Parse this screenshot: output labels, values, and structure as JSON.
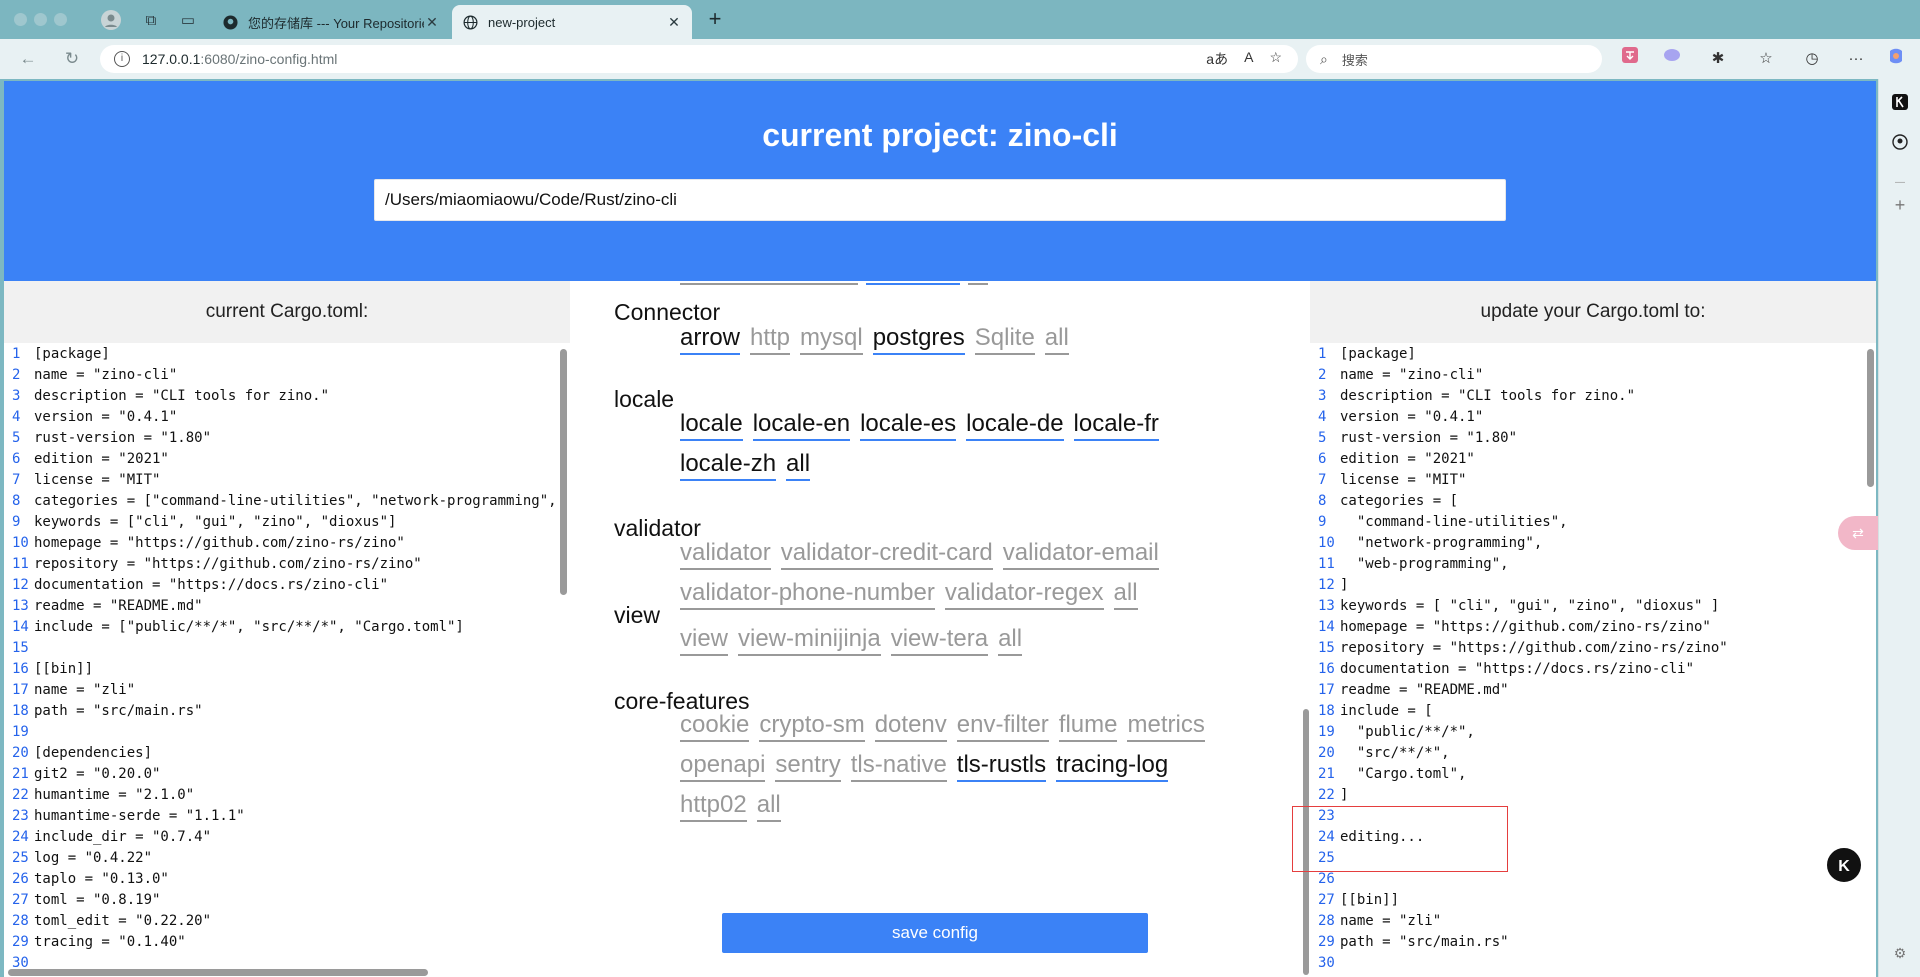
{
  "browser": {
    "tabs": [
      {
        "title": "您的存储库 --- Your Repositories",
        "active": false
      },
      {
        "title": "new-project",
        "active": true
      }
    ],
    "url_host": "127.0.0.1",
    "url_path": ":6080/zino-config.html",
    "search_placeholder": "搜索",
    "url_actions": [
      "aあ",
      "A",
      "☆"
    ]
  },
  "hero": {
    "title": "current project: zino-cli",
    "path_value": "/Users/miaomiaowu/Code/Rust/zino-cli"
  },
  "left_panel": {
    "title": "current Cargo.toml:",
    "lines": [
      {
        "n": "1",
        "t": "[package]"
      },
      {
        "n": "2",
        "t": "name = \"zino-cli\""
      },
      {
        "n": "3",
        "t": "description = \"CLI tools for zino.\""
      },
      {
        "n": "4",
        "t": "version = \"0.4.1\""
      },
      {
        "n": "5",
        "t": "rust-version = \"1.80\""
      },
      {
        "n": "6",
        "t": "edition = \"2021\""
      },
      {
        "n": "7",
        "t": "license = \"MIT\""
      },
      {
        "n": "8",
        "t": "categories = [\"command-line-utilities\", \"network-programming\","
      },
      {
        "n": "9",
        "t": "keywords = [\"cli\", \"gui\", \"zino\", \"dioxus\"]"
      },
      {
        "n": "10",
        "t": "homepage = \"https://github.com/zino-rs/zino\""
      },
      {
        "n": "11",
        "t": "repository = \"https://github.com/zino-rs/zino\""
      },
      {
        "n": "12",
        "t": "documentation = \"https://docs.rs/zino-cli\""
      },
      {
        "n": "13",
        "t": "readme = \"README.md\""
      },
      {
        "n": "14",
        "t": "include = [\"public/**/*\", \"src/**/*\", \"Cargo.toml\"]"
      },
      {
        "n": "15",
        "t": ""
      },
      {
        "n": "16",
        "t": "[[bin]]"
      },
      {
        "n": "17",
        "t": "name = \"zli\""
      },
      {
        "n": "18",
        "t": "path = \"src/main.rs\""
      },
      {
        "n": "19",
        "t": ""
      },
      {
        "n": "20",
        "t": "[dependencies]"
      },
      {
        "n": "21",
        "t": "git2 = \"0.20.0\""
      },
      {
        "n": "22",
        "t": "humantime = \"2.1.0\""
      },
      {
        "n": "23",
        "t": "humantime-serde = \"1.1.1\""
      },
      {
        "n": "24",
        "t": "include_dir = \"0.7.4\""
      },
      {
        "n": "25",
        "t": "log = \"0.4.22\""
      },
      {
        "n": "26",
        "t": "taplo = \"0.13.0\""
      },
      {
        "n": "27",
        "t": "toml = \"0.8.19\""
      },
      {
        "n": "28",
        "t": "toml_edit = \"0.22.20\""
      },
      {
        "n": "29",
        "t": "tracing = \"0.1.40\""
      },
      {
        "n": "30",
        "t": ""
      }
    ]
  },
  "right_panel": {
    "title": "update your Cargo.toml to:",
    "lines": [
      {
        "n": "1",
        "t": "[package]"
      },
      {
        "n": "2",
        "t": "name = \"zino-cli\""
      },
      {
        "n": "3",
        "t": "description = \"CLI tools for zino.\""
      },
      {
        "n": "4",
        "t": "version = \"0.4.1\""
      },
      {
        "n": "5",
        "t": "rust-version = \"1.80\""
      },
      {
        "n": "6",
        "t": "edition = \"2021\""
      },
      {
        "n": "7",
        "t": "license = \"MIT\""
      },
      {
        "n": "8",
        "t": "categories = ["
      },
      {
        "n": "9",
        "t": "  \"command-line-utilities\","
      },
      {
        "n": "10",
        "t": "  \"network-programming\","
      },
      {
        "n": "11",
        "t": "  \"web-programming\","
      },
      {
        "n": "12",
        "t": "]"
      },
      {
        "n": "13",
        "t": "keywords = [ \"cli\", \"gui\", \"zino\", \"dioxus\" ]"
      },
      {
        "n": "14",
        "t": "homepage = \"https://github.com/zino-rs/zino\""
      },
      {
        "n": "15",
        "t": "repository = \"https://github.com/zino-rs/zino\""
      },
      {
        "n": "16",
        "t": "documentation = \"https://docs.rs/zino-cli\""
      },
      {
        "n": "17",
        "t": "readme = \"README.md\""
      },
      {
        "n": "18",
        "t": "include = ["
      },
      {
        "n": "19",
        "t": "  \"public/**/*\","
      },
      {
        "n": "20",
        "t": "  \"src/**/*\","
      },
      {
        "n": "21",
        "t": "  \"Cargo.toml\","
      },
      {
        "n": "22",
        "t": "]"
      },
      {
        "n": "23",
        "t": ""
      },
      {
        "n": "24",
        "t": "editing..."
      },
      {
        "n": "25",
        "t": ""
      },
      {
        "n": "26",
        "t": ""
      },
      {
        "n": "27",
        "t": "[[bin]]"
      },
      {
        "n": "28",
        "t": "name = \"zli\""
      },
      {
        "n": "29",
        "t": "path = \"src/main.rs\""
      },
      {
        "n": "30",
        "t": ""
      }
    ]
  },
  "groups": [
    {
      "title": "Connector",
      "features": [
        {
          "label": "arrow",
          "on": true
        },
        {
          "label": "http",
          "on": false
        },
        {
          "label": "mysql",
          "on": false
        },
        {
          "label": "postgres",
          "on": true
        },
        {
          "label": "Sqlite",
          "on": false
        },
        {
          "label": "all",
          "on": false
        }
      ]
    },
    {
      "title": "locale",
      "features": [
        {
          "label": "locale",
          "on": true
        },
        {
          "label": "locale-en",
          "on": true
        },
        {
          "label": "locale-es",
          "on": true
        },
        {
          "label": "locale-de",
          "on": true
        },
        {
          "label": "locale-fr",
          "on": true
        },
        {
          "label": "locale-zh",
          "on": true
        },
        {
          "label": "all",
          "on": true
        }
      ]
    },
    {
      "title": "validator",
      "features": [
        {
          "label": "validator",
          "on": false
        },
        {
          "label": "validator-credit-card",
          "on": false
        },
        {
          "label": "validator-email",
          "on": false
        },
        {
          "label": "validator-phone-number",
          "on": false
        },
        {
          "label": "validator-regex",
          "on": false
        },
        {
          "label": "all",
          "on": false
        }
      ]
    },
    {
      "title": "view",
      "features": [
        {
          "label": "view",
          "on": false
        },
        {
          "label": "view-minijinja",
          "on": false
        },
        {
          "label": "view-tera",
          "on": false
        },
        {
          "label": "all",
          "on": false
        }
      ]
    },
    {
      "title": "core-features",
      "features": [
        {
          "label": "cookie",
          "on": false
        },
        {
          "label": "crypto-sm",
          "on": false
        },
        {
          "label": "dotenv",
          "on": false
        },
        {
          "label": "env-filter",
          "on": false
        },
        {
          "label": "flume",
          "on": false
        },
        {
          "label": "metrics",
          "on": false
        },
        {
          "label": "openapi",
          "on": false
        },
        {
          "label": "sentry",
          "on": false
        },
        {
          "label": "tls-native",
          "on": false
        },
        {
          "label": "tls-rustls",
          "on": true
        },
        {
          "label": "tracing-log",
          "on": true
        },
        {
          "label": "http02",
          "on": false
        },
        {
          "label": "all",
          "on": false
        }
      ]
    }
  ],
  "save_label": "save config",
  "colors": {
    "accent": "#3b82f6",
    "line_number": "#2563eb",
    "disabled": "#999999",
    "highlight_box": "#e53e3e"
  }
}
